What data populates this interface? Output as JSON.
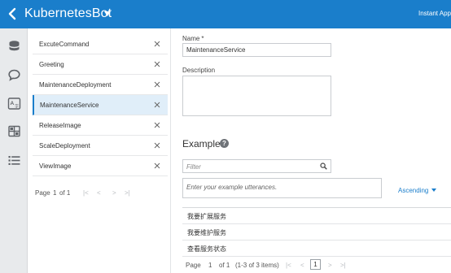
{
  "header": {
    "title": "KubernetesBot",
    "right_label": "Instant App"
  },
  "rail": {
    "icons": [
      "database-icon",
      "chat-bubble-icon",
      "translate-icon",
      "components-icon",
      "list-icon"
    ]
  },
  "intents": {
    "items": [
      {
        "label": "ExcuteCommand"
      },
      {
        "label": "Greeting"
      },
      {
        "label": "MaintenanceDeployment"
      },
      {
        "label": "MaintenanceService",
        "selected": true
      },
      {
        "label": "ReleaseImage"
      },
      {
        "label": "ScaleDeployment"
      },
      {
        "label": "ViewImage"
      }
    ],
    "pager": {
      "page_label": "Page",
      "page_value": "1",
      "of_label": "of 1"
    }
  },
  "form": {
    "name_label": "Name",
    "name_required": "*",
    "name_value": "MaintenanceService",
    "description_label": "Description",
    "examples_title": "Examples",
    "help_glyph": "?",
    "filter_placeholder": "Filter",
    "utterance_placeholder": "Enter your example utterances.",
    "sort_label": "Ascending",
    "utterances": [
      {
        "text": "我要扩展服务"
      },
      {
        "text": "我要维护服务"
      },
      {
        "text": "查看服务状态"
      }
    ],
    "pager": {
      "page_label": "Page",
      "page_value": "1",
      "of_label": "of 1",
      "items_label": "(1-3 of 3 items)",
      "current_page": "1"
    }
  },
  "colors": {
    "header": "#1a7ecb",
    "selected_bg": "#e0eef9",
    "rail_bg": "#e8eaec",
    "accent": "#1a7ecb"
  }
}
